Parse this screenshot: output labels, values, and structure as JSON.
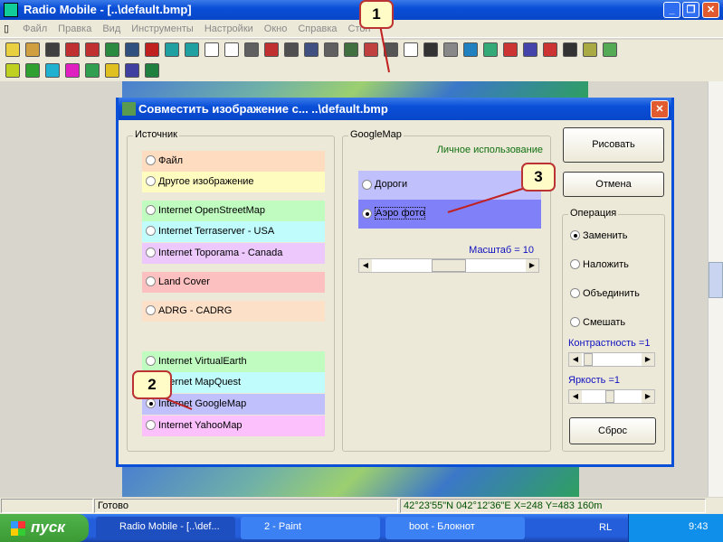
{
  "window": {
    "title": "Radio Mobile - [..\\default.bmp]",
    "minimize": "_",
    "restore": "❐",
    "close": "✕"
  },
  "menu": [
    "Файл",
    "Правка",
    "Вид",
    "Инструменты",
    "Настройки",
    "Окно",
    "Справка",
    "Стоп"
  ],
  "toolbar_colors": [
    "#e8d040",
    "#d0a040",
    "#404040",
    "#c03030",
    "#c03030",
    "#2a8a40",
    "#305080",
    "#c02020",
    "#20a0a0",
    "#20a0a0",
    "#fff",
    "#fff",
    "#606060",
    "#c03030",
    "#505050",
    "#405080",
    "#606060",
    "#407040",
    "#c04040",
    "#555",
    "#fff",
    "#333",
    "#888",
    "#2080c0",
    "#3a7",
    "#c33",
    "#44a",
    "#c33",
    "#333",
    "#aa4",
    "#5a5"
  ],
  "toolbar2_colors": [
    "#c0d020",
    "#30a030",
    "#20b0d0",
    "#e020c0",
    "#30a050",
    "#e0c020",
    "#4040a0",
    "#208040"
  ],
  "dialog": {
    "title": "Совместить изображение с... ..\\default.bmp",
    "source": {
      "label": "Источник",
      "items": [
        {
          "label": "Файл",
          "color": "#fddcc0",
          "selected": false
        },
        {
          "label": "Другое изображение",
          "color": "#fffcc0",
          "selected": false
        },
        {
          "label": "Internet OpenStreetMap",
          "color": "#c0fcc0",
          "selected": false
        },
        {
          "label": "Internet Terraserver - USA",
          "color": "#c0fcfc",
          "selected": false
        },
        {
          "label": "Internet Toporama - Canada",
          "color": "#ecc8fc",
          "selected": false
        },
        {
          "label": "Land Cover",
          "color": "#fcc0c0",
          "selected": false
        },
        {
          "label": "ADRG - CADRG",
          "color": "#fde0c8",
          "selected": false
        },
        {
          "label": "Internet VirtualEarth",
          "color": "#c0fcc0",
          "selected": false
        },
        {
          "label": "Internet MapQuest",
          "color": "#c0fcfc",
          "selected": false
        },
        {
          "label": "Internet GoogleMap",
          "color": "#c0c0fc",
          "selected": true
        },
        {
          "label": "Internet YahooMap",
          "color": "#fcc0fc",
          "selected": false
        }
      ]
    },
    "googlemap": {
      "label": "GoogleMap",
      "usage": "Личное использование",
      "roads": "Дороги",
      "aerial": "Аэро фото",
      "selected": "Аэро фото",
      "scale_label": "Масштаб = 10",
      "scale": 10
    },
    "draw_button": "Рисовать",
    "cancel_button": "Отмена",
    "operation": {
      "label": "Операция",
      "items": [
        "Заменить",
        "Наложить",
        "Объединить",
        "Смешать"
      ],
      "selected": "Заменить"
    },
    "contrast_label": "Контрастность =1",
    "brightness_label": "Яркость =1",
    "reset_button": "Сброс"
  },
  "status": {
    "text": "Готово",
    "coords": "42°23'55\"N 042°12'36\"E  X=248 Y=483 160m"
  },
  "taskbar": {
    "start": "пуск",
    "tasks": [
      "Radio Mobile - [..\\def...",
      "2 - Paint",
      "boot - Блокнот"
    ],
    "lang": "RL",
    "clock": "9:43"
  },
  "callouts": [
    "1",
    "2",
    "3"
  ]
}
